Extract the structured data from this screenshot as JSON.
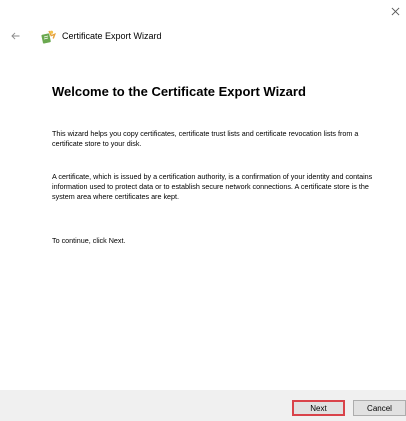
{
  "window": {
    "close_icon": "close-icon",
    "back_icon": "back-arrow-icon",
    "wizard_icon": "certificate-wizard-icon",
    "title": "Certificate Export Wizard"
  },
  "content": {
    "heading": "Welcome to the Certificate Export Wizard",
    "paragraph_1": "This wizard helps you copy certificates, certificate trust lists and certificate revocation lists from a certificate store to your disk.",
    "paragraph_2": "A certificate, which is issued by a certification authority, is a confirmation of your identity and contains information used to protect data or to establish secure network connections. A certificate store is the system area where certificates are kept.",
    "paragraph_3": "To continue, click Next."
  },
  "footer": {
    "next_label": "Next",
    "cancel_label": "Cancel"
  },
  "colors": {
    "footer_background": "#f0f0f0",
    "next_highlight_border": "#d9434a",
    "button_background": "#e1e1e1"
  }
}
